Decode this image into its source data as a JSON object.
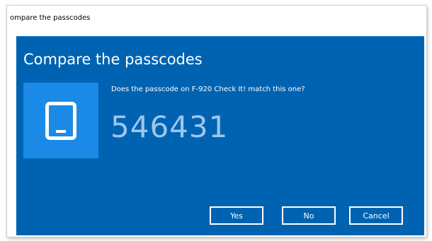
{
  "window": {
    "title": "ompare the passcodes"
  },
  "dialog": {
    "heading": "Compare the passcodes",
    "question": "Does the passcode on F-920 Check It! match this one?",
    "passcode": "546431",
    "device_icon": "phone-icon"
  },
  "buttons": {
    "yes_label": "Yes",
    "no_label": "No",
    "cancel_label": "Cancel"
  },
  "colors": {
    "dialog_background": "#0063b1",
    "tile_background": "#1b8ae6",
    "passcode_text": "#9ec6ec",
    "button_border": "#ffffff"
  }
}
